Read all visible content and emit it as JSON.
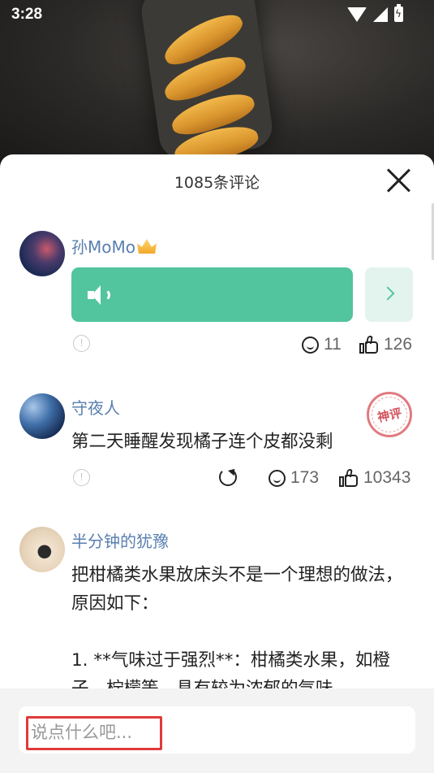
{
  "status_bar": {
    "time": "3:28"
  },
  "sheet": {
    "title": "1085条评论"
  },
  "comments": [
    {
      "username": "孙MoMo",
      "badge": "crown-icon",
      "type": "voice",
      "reply_count": "11",
      "like_count": "126"
    },
    {
      "username": "守夜人",
      "text": "第二天睡醒发现橘子连个皮都没剩",
      "stamp": "神评",
      "reply_count": "173",
      "like_count": "10343"
    },
    {
      "username": "半分钟的犹豫",
      "text": "把柑橘类水果放床头不是一个理想的做法，原因如下：\n\n1. **气味过于强烈**：柑橘类水果，如橙子、柠檬等，具有较为浓郁的气味。"
    }
  ],
  "input": {
    "placeholder": "说点什么吧..."
  },
  "colors": {
    "accent": "#52c49e",
    "username": "#5a7fb0",
    "highlight": "#e03a3a"
  }
}
